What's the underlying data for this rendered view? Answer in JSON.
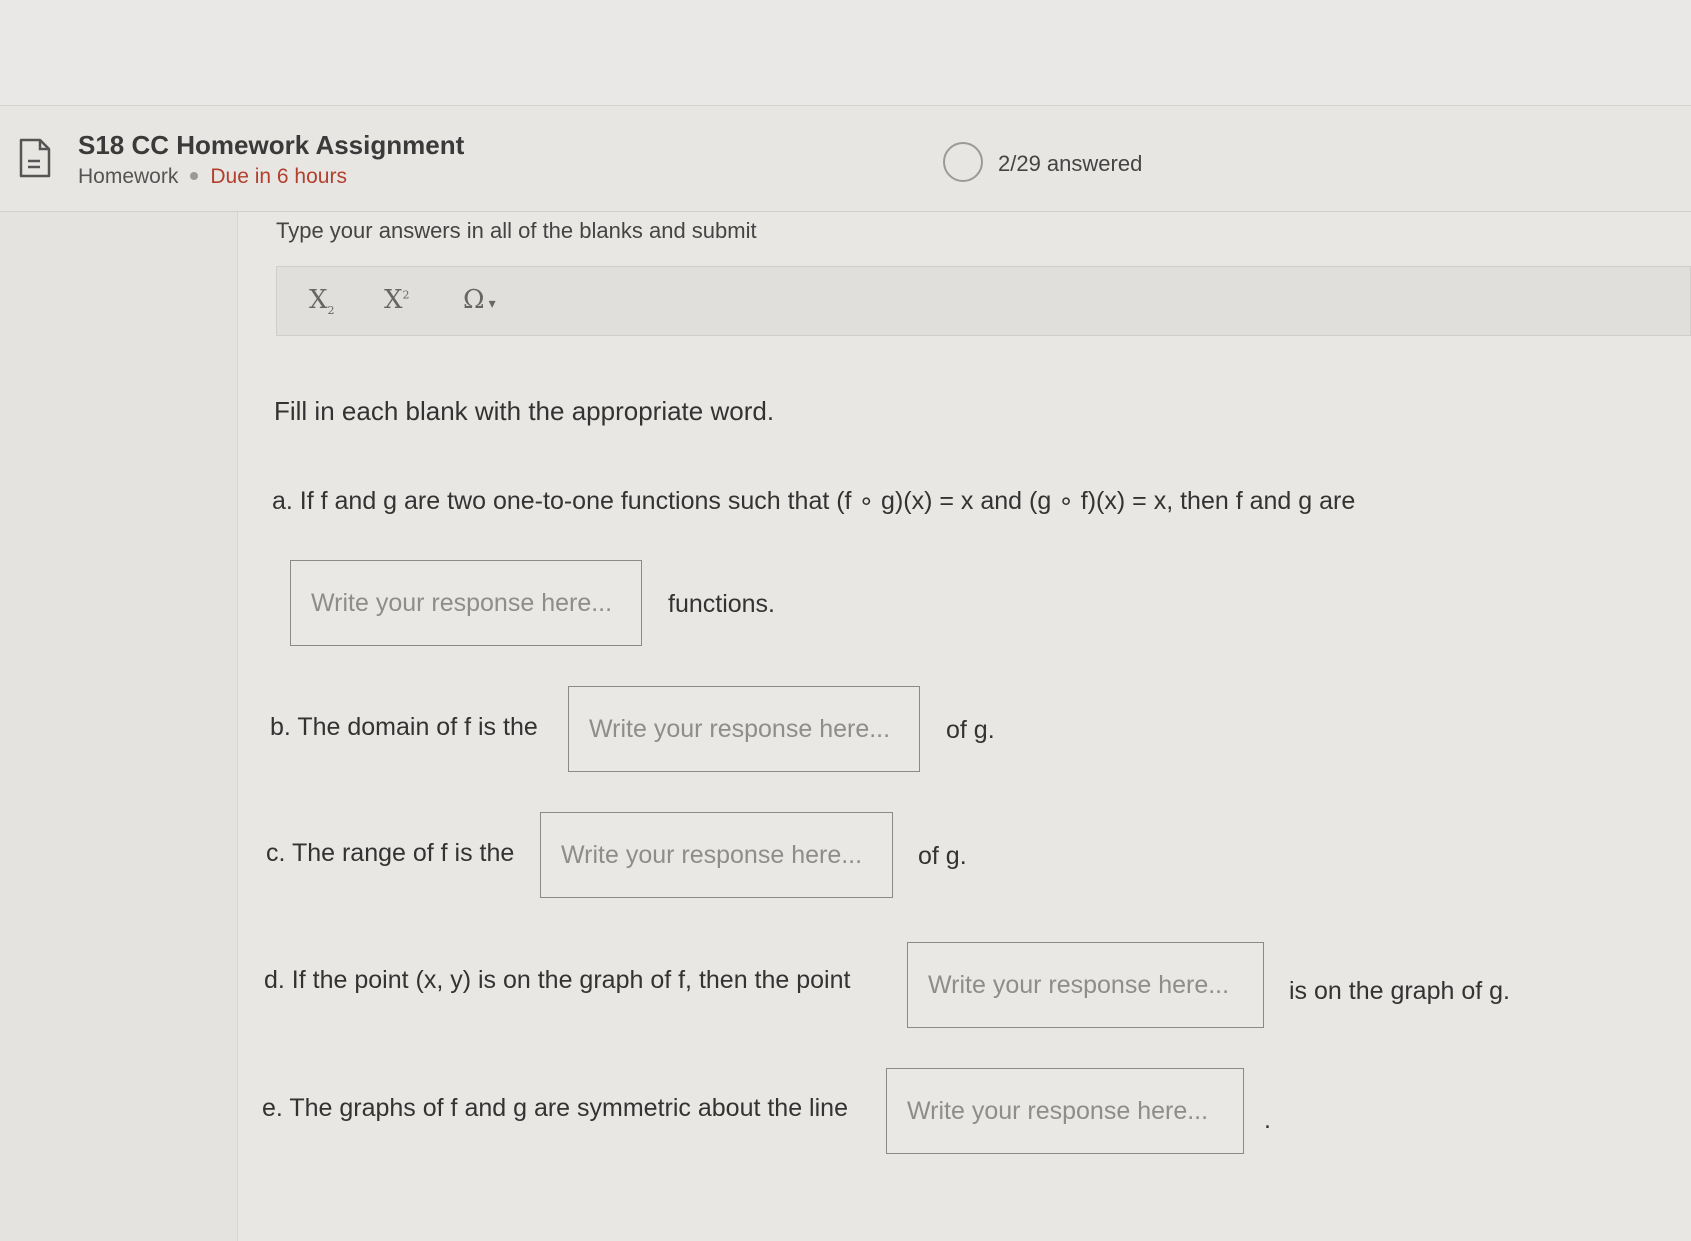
{
  "header": {
    "title": "S18 CC Homework Assignment",
    "type": "Homework",
    "due": "Due in 6 hours",
    "progress": "2/29 answered",
    "icon": "document-icon"
  },
  "instructions": "Type your answers in all of the blanks and submit",
  "toolbar": {
    "subscript": "X",
    "superscript": "X",
    "special_chars": "Ω"
  },
  "prompt": "Fill in each blank with the appropriate word.",
  "questions": {
    "a": {
      "text": "a. If f and g are two one-to-one functions such that (f ∘ g)(x) = x and (g ∘ f)(x) = x, then f and g are",
      "after": "functions."
    },
    "b": {
      "before": "b. The domain of f is the",
      "after": "of g."
    },
    "c": {
      "before": "c. The range of f is the",
      "after": "of g."
    },
    "d": {
      "before": "d. If the point (x, y) is on the graph of f, then the point",
      "after": "is on the graph of g."
    },
    "e": {
      "before": "e. The graphs of f and g are symmetric about the line",
      "after": "."
    }
  },
  "placeholder": "Write your response here..."
}
